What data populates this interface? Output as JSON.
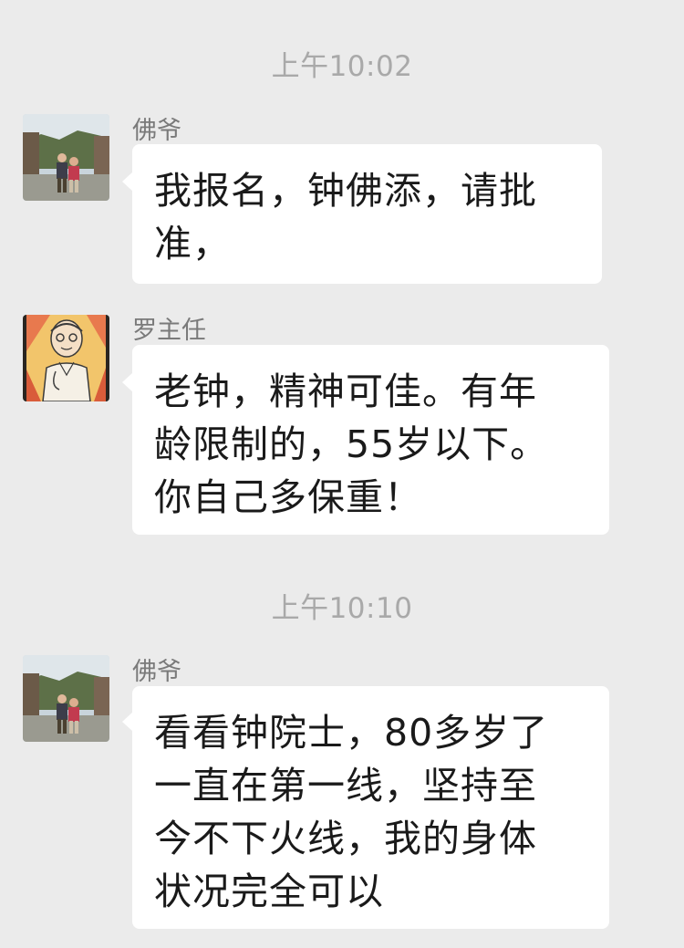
{
  "chat": {
    "background_color": "#ebebeb",
    "groups": [
      {
        "timestamp": "上午10:02",
        "messages": [
          {
            "sender": "佛爷",
            "avatar_icon": "person-photo-avatar",
            "text": "我报名，钟佛添，请批\n准，"
          },
          {
            "sender": "罗主任",
            "avatar_icon": "cartoon-doctor-avatar",
            "text": "老钟，精神可佳。有年\n龄限制的，55岁以下。\n你自己多保重！"
          }
        ]
      },
      {
        "timestamp": "上午10:10",
        "messages": [
          {
            "sender": "佛爷",
            "avatar_icon": "person-photo-avatar",
            "text": "看看钟院士，80多岁了\n一直在第一线，坚持至\n今不下火线，我的身体\n状况完全可以"
          }
        ]
      }
    ]
  }
}
